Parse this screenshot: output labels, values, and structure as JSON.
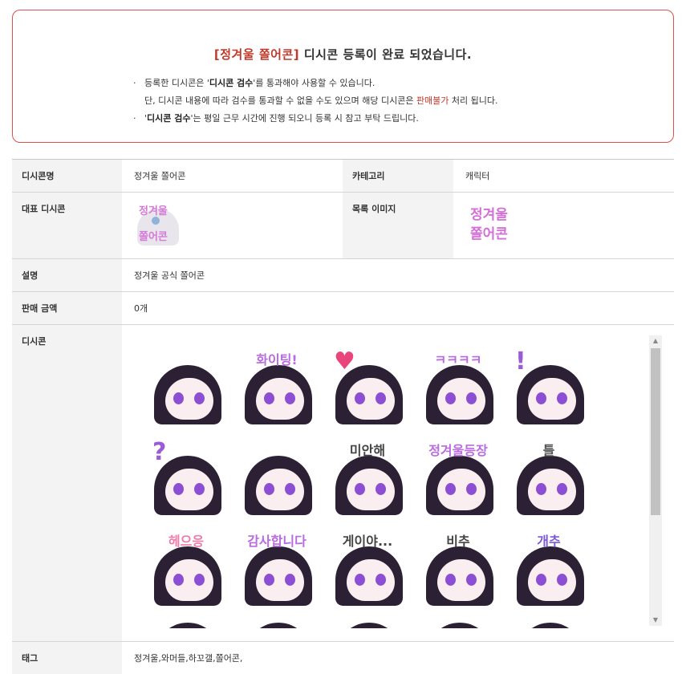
{
  "notice": {
    "title_highlight": "[정겨울 쫄어콘]",
    "title_rest": " 디시콘 등록이 완료 되었습니다.",
    "line1_bullet": "·",
    "line1_pre": "등록한 디시콘은 '",
    "line1_bold": "디시콘 검수",
    "line1_post": "'를 통과해야 사용할 수 있습니다.",
    "line2_pre": "단, 디시콘 내용에 따라 검수를 통과할 수 없을 수도 있으며 해당 디시콘은 ",
    "line2_red": "판매불가",
    "line2_post": " 처리 됩니다.",
    "line3_bullet": "·",
    "line3_pre": "'",
    "line3_bold": "디시콘 검수",
    "line3_post": "'는 평일 근무 시간에 진행 되오니 등록 시 참고 부탁 드립니다."
  },
  "info": {
    "name_label": "디시콘명",
    "name_value": "정겨울 쫄어콘",
    "category_label": "카테고리",
    "category_value": "캐릭터",
    "rep_label": "대표 디시콘",
    "rep_text_top": "정겨울",
    "rep_text_bottom": "쫄어콘",
    "list_label": "목록 이미지",
    "list_text_top": "정겨울",
    "list_text_bottom": "쫄어콘",
    "desc_label": "설명",
    "desc_value": "정겨울 공식 쫄어콘",
    "price_label": "판매 금액",
    "price_value": "0개",
    "dccon_label": "디시콘",
    "tag_label": "태그",
    "tag_value": "정겨울,와머들,하꼬갤,쫄어콘,"
  },
  "scrollbar": {
    "up_icon": "▲",
    "down_icon": "▼"
  },
  "dccons": [
    {
      "caption": "",
      "mark": "",
      "color": "#555555"
    },
    {
      "caption": "화이팅!",
      "mark": "",
      "color": "#b96be0"
    },
    {
      "caption": "",
      "mark": "♥",
      "color": "#e8457a"
    },
    {
      "caption": "ㅋㅋㅋㅋ",
      "mark": "",
      "color": "#b96be0"
    },
    {
      "caption": "",
      "mark": "!",
      "color": "#9b5bd6"
    },
    {
      "caption": "",
      "mark": "?",
      "color": "#9b5bd6"
    },
    {
      "caption": "",
      "mark": "",
      "color": "#555555"
    },
    {
      "caption": "미안해",
      "mark": "",
      "color": "#444444"
    },
    {
      "caption": "정겨울등장",
      "mark": "",
      "color": "#b96be0"
    },
    {
      "caption": "틀",
      "mark": "",
      "color": "#555555"
    },
    {
      "caption": "헤으응",
      "mark": "",
      "color": "#f07aa8"
    },
    {
      "caption": "감사합니다",
      "mark": "",
      "color": "#b96be0"
    },
    {
      "caption": "게이야...",
      "mark": "",
      "color": "#444444"
    },
    {
      "caption": "비추",
      "mark": "",
      "color": "#444444"
    },
    {
      "caption": "개추",
      "mark": "",
      "color": "#7a58d8"
    }
  ]
}
